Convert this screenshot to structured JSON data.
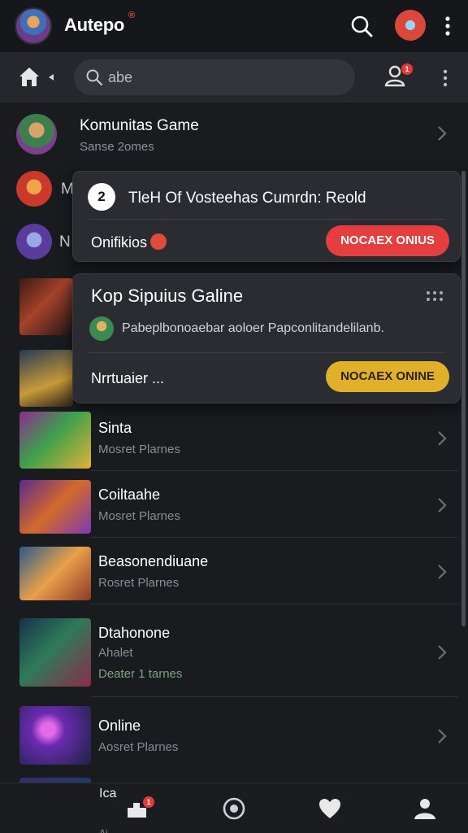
{
  "header": {
    "app_title": "Autepo",
    "title_mark": "®",
    "icons": [
      "app-logo",
      "search-icon",
      "avatar",
      "more-vertical-icon"
    ]
  },
  "navbar": {
    "search_placeholder": "abe",
    "user_badge": "1",
    "icons": [
      "home-icon",
      "caret-left-icon",
      "search-icon",
      "user-icon",
      "more-vertical-icon"
    ]
  },
  "community": {
    "title": "Komunitas Game",
    "subtitle": "Sanse 2omes"
  },
  "side_letters": [
    "M",
    "N"
  ],
  "notification_card": {
    "icon_text": "2",
    "title": "TleH Of Vosteehas Cumrdn: Reold",
    "status": "Onifikios",
    "button": "NOCAEX ONIUS"
  },
  "featured_card": {
    "title": "Kop Sipuius Galine",
    "description": "Pabeplbonoaebar aoloer Papconlitandelilanb.",
    "status": "Nrrtuaier ...",
    "button": "NOCAEX ONINE"
  },
  "games": [
    {
      "title": "Sinta",
      "subtitle": "Mosret Plarnes"
    },
    {
      "title": "Coiltaahe",
      "subtitle": "Mosret Plarnes"
    },
    {
      "title": "Beasonendiuane",
      "subtitle": "Rosret Plarnes"
    },
    {
      "title": "Dtahonone",
      "subtitle2": "Ahalet",
      "subtitle": "Deater 1 tarnes"
    },
    {
      "title": "Online",
      "subtitle": "Aosret Plarnes"
    }
  ],
  "partial_row": {
    "title": "Ica",
    "subtitle": "Ai"
  },
  "bottom_nav": {
    "tabs": [
      "home-tab",
      "discover-tab",
      "favorites-tab",
      "profile-tab"
    ],
    "home_badge": "1"
  },
  "colors": {
    "background": "#1a1b1f",
    "accent_red": "#e53e3e",
    "accent_yellow": "#e0b02a"
  }
}
